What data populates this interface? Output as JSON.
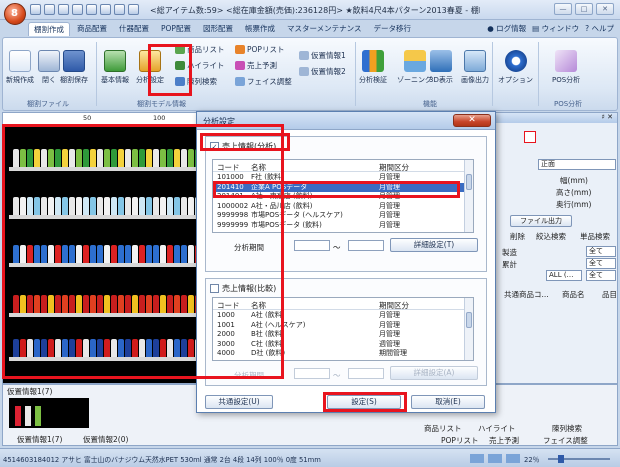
{
  "window": {
    "title": "<総アイテム数:59> <総在庫金額(売価):236128円> ★飲料4尺4本パターン2013春夏 - 棚POWER",
    "controls": [
      "—",
      "□",
      "✕"
    ]
  },
  "tabs": [
    "棚割作成",
    "商品配置",
    "什器配置",
    "POP配置",
    "図形配置",
    "帳票作成",
    "マスターメンテナンス",
    "データ移行"
  ],
  "help_menu": [
    "ログ情報",
    "ウィンドウ",
    "ヘルプ"
  ],
  "ribbon": {
    "new": "新規作成",
    "close": "閉く",
    "save": "棚割保存",
    "basic_info": "基本情報",
    "analysis_settings": "分析設定",
    "product_list": "商品リスト",
    "pop_list": "POPリスト",
    "highlight": "ハイライト",
    "sales_forecast": "売上予測",
    "temp_info1": "仮置情報1",
    "temp_info2": "仮置情報2",
    "layout_search": "陳列検索",
    "face_adjust": "フェイス調整",
    "analysis_verify": "分析検証",
    "zoning": "ゾーニング",
    "view3d": "3D表示",
    "image_output": "画像出力",
    "option": "オプション",
    "pos_analysis": "POS分析",
    "group_file": "棚割ファイル",
    "group_model": "棚割モデル情報",
    "group_analysis": "POS分析",
    "group_misc": "機能"
  },
  "ruler": [
    "50",
    "100"
  ],
  "lower": {
    "temp_title": "仮置情報1(7)",
    "temp_tab1": "仮置情報1(7)",
    "temp_tab2": "仮置情報2(0)",
    "links_row1": [
      "商品リスト",
      "ハイライト",
      "陳列検索"
    ],
    "links_row2": [
      "POPリスト",
      "売上予測",
      "フェイス調整"
    ]
  },
  "status": {
    "text": "4514603184012 アサヒ 富士山のバナジウム天然水PET 530ml 通常 2台 4段 14列 100％ 0度 51mm",
    "zoom": "22％"
  },
  "right_panel": {
    "front": "正面",
    "width": "幅(mm)",
    "height": "高さ(mm)",
    "depth": "奥行(mm)",
    "file_output": "ファイル出力",
    "delete": "削除",
    "filter_search": "絞込検索",
    "item_search": "単品検索",
    "maker": "製造",
    "cumulative": "累計",
    "all": "全て",
    "all_short": "ALL (…",
    "common_product": "共通商品コ...",
    "product_name": "商品名",
    "item": "品目"
  },
  "dialog": {
    "title": "分析設定",
    "sales_analysis_label": "売上情報(分析)",
    "sales_analysis_checked": true,
    "col_code": "コード",
    "col_name": "名称",
    "col_period": "期間区分",
    "list1": [
      {
        "code": "101000",
        "name": "F社 (飲料)",
        "period": "月管理"
      },
      {
        "code": "201410",
        "name": "企業A POSデータ",
        "period": "月管理",
        "selected": true
      },
      {
        "code": "201401",
        "name": "A社・東京店 (飲料)",
        "period": "月管理"
      },
      {
        "code": "1000002",
        "name": "A社・品川店 (飲料)",
        "period": "月管理"
      },
      {
        "code": "9999998",
        "name": "市場POSデータ (ヘルスケア)",
        "period": "月管理"
      },
      {
        "code": "9999999",
        "name": "市場POSデータ (飲料)",
        "period": "月管理"
      }
    ],
    "period_label": "分析期間",
    "tilde": "～",
    "detail_btn1": "詳細設定(T)",
    "sales_compare_label": "売上情報(比較)",
    "sales_compare_checked": false,
    "list2": [
      {
        "code": "1000",
        "name": "A社 (飲料)",
        "period": "月管理"
      },
      {
        "code": "1001",
        "name": "A社 (ヘルスケア)",
        "period": "月管理"
      },
      {
        "code": "2000",
        "name": "B社 (飲料)",
        "period": "月管理"
      },
      {
        "code": "3000",
        "name": "C社 (飲料)",
        "period": "週管理"
      },
      {
        "code": "4000",
        "name": "D社 (飲料)",
        "period": "期間管理"
      }
    ],
    "period_label2": "分析期間",
    "detail_btn2": "詳細設定(A)",
    "common_btn": "共通設定(U)",
    "ok_btn": "設定(S)",
    "cancel_btn": "取消(E)"
  },
  "colors": {
    "highlight_red": "#e8141e",
    "selection_blue": "#3a6cc2"
  }
}
